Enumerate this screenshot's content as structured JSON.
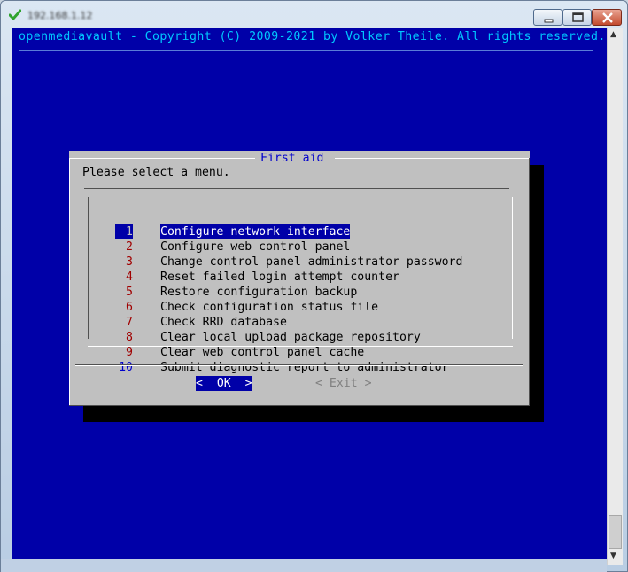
{
  "window": {
    "title": "192.168.1.12",
    "controls": {
      "minimize": "minimize",
      "maximize": "maximize",
      "close": "close"
    }
  },
  "terminal": {
    "copyright": "openmediavault - Copyright (C) 2009-2021 by Volker Theile. All rights reserved."
  },
  "dialog": {
    "title": "First aid",
    "prompt": "Please select a menu.",
    "selected_index": 0,
    "items": [
      {
        "number": "1",
        "label": "Configure network interface"
      },
      {
        "number": "2",
        "label": "Configure web control panel"
      },
      {
        "number": "3",
        "label": "Change control panel administrator password"
      },
      {
        "number": "4",
        "label": "Reset failed login attempt counter"
      },
      {
        "number": "5",
        "label": "Restore configuration backup"
      },
      {
        "number": "6",
        "label": "Check configuration status file"
      },
      {
        "number": "7",
        "label": "Check RRD database"
      },
      {
        "number": "8",
        "label": "Clear local upload package repository"
      },
      {
        "number": "9",
        "label": "Clear web control panel cache"
      },
      {
        "number": "10",
        "label": "Submit diagnostic report to administrator"
      }
    ],
    "ok_label": "<  OK  >",
    "exit_label": "< Exit >"
  },
  "colors": {
    "terminal_bg": "#0000a8",
    "dialog_bg": "#c0c0c0",
    "title": "#0000cc",
    "number": "#a00000",
    "highlight": "#0000a8",
    "copyright": "#00c8ff"
  },
  "icons": {
    "title": "green-check-icon",
    "scroll_up": "scroll-up-arrow-icon",
    "scroll_down": "scroll-down-arrow-icon"
  }
}
